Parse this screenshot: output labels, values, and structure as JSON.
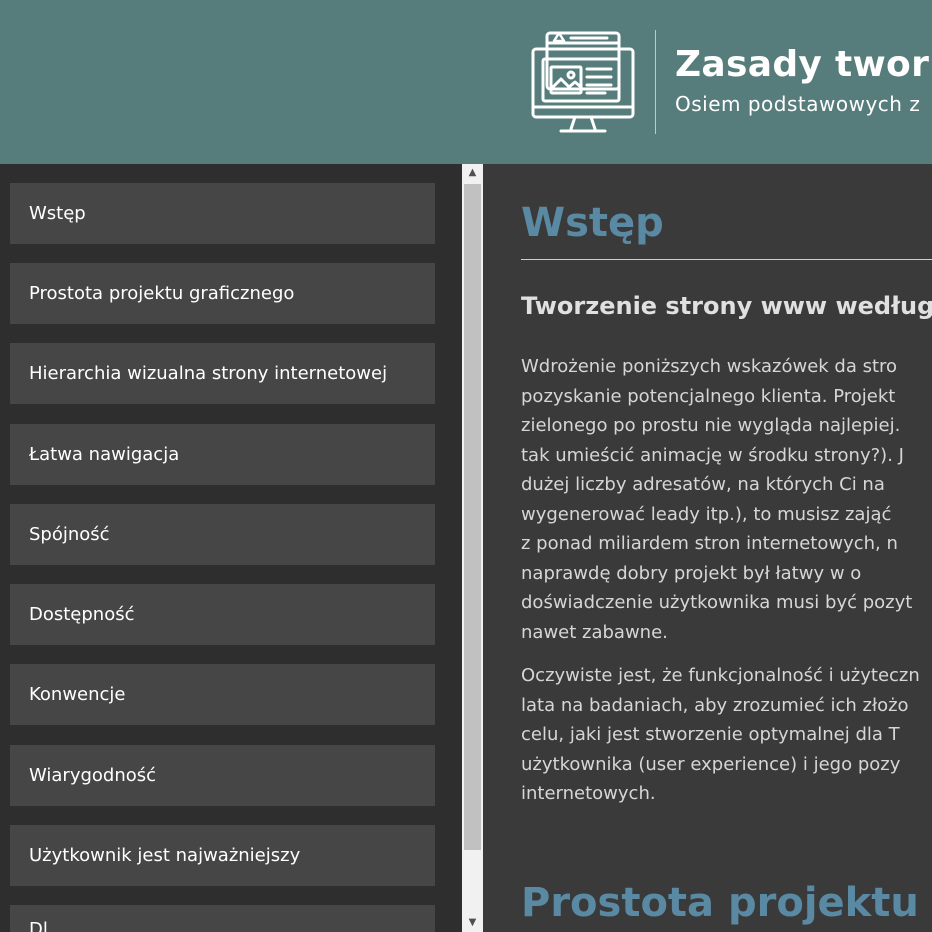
{
  "header": {
    "title": "Zasady twor",
    "subtitle": "Osiem podstawowych z",
    "logo_icon": "web-design-monitor-icon",
    "background_color": "#567d7b"
  },
  "sidebar": {
    "items": [
      {
        "label": "Wstęp"
      },
      {
        "label": "Prostota projektu graficznego"
      },
      {
        "label": "Hierarchia wizualna strony internetowej"
      },
      {
        "label": "Łatwa nawigacja"
      },
      {
        "label": "Spójność"
      },
      {
        "label": "Dostępność"
      },
      {
        "label": "Konwencje"
      },
      {
        "label": "Wiarygodność"
      },
      {
        "label": "Użytkownik jest najważniejszy"
      },
      {
        "label": "Dl"
      }
    ]
  },
  "scrollbar": {
    "up_arrow": "▲",
    "down_arrow": "▼"
  },
  "content": {
    "section_title": "Wstęp",
    "subheading": "Tworzenie strony www według",
    "paragraph1_lines": [
      "Wdrożenie poniższych wskazówek da stro",
      "pozyskanie potencjalnego klienta. Projekt",
      "zielonego po prostu nie wygląda najlepiej.",
      "tak umieścić animację w środku strony?). J",
      "dużej liczby adresatów, na których Ci na",
      "wygenerować leady itp.), to musisz zająć",
      "z ponad miliardem stron internetowych, n",
      "naprawdę dobry projekt był łatwy w o",
      "doświadczenie użytkownika musi być pozyt",
      "nawet zabawne."
    ],
    "paragraph2_lines": [
      "Oczywiste jest, że funkcjonalność i użyteczn",
      "lata na badaniach, aby zrozumieć ich złożo",
      "celu, jaki jest stworzenie optymalnej dla T",
      "użytkownika (user experience) i jego pozy",
      "internetowych."
    ],
    "next_section_title": "Prostota projektu g",
    "heading_color": "#5a8aa3"
  }
}
